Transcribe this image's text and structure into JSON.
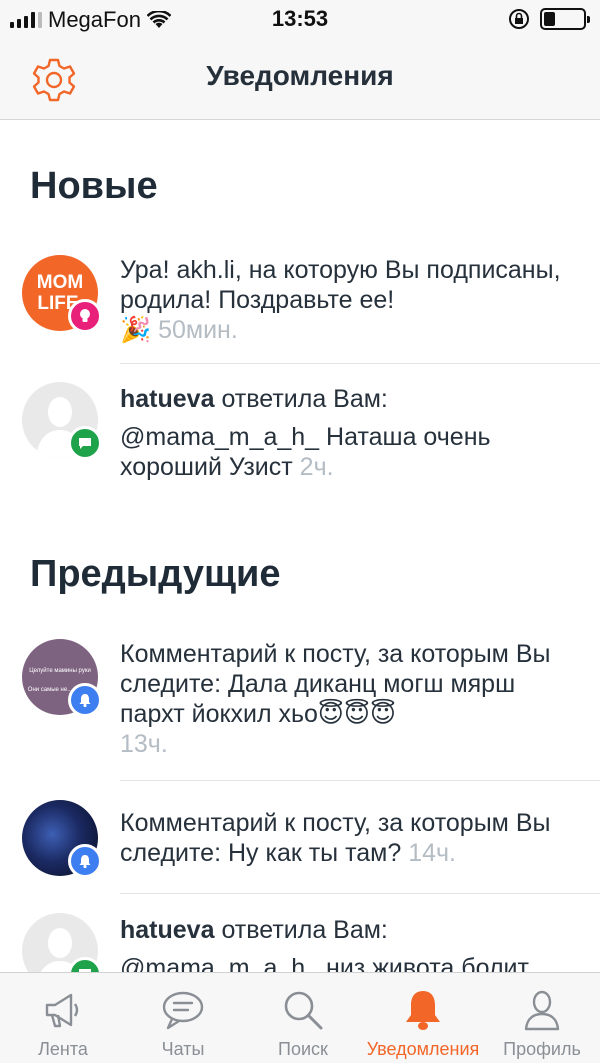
{
  "status_bar": {
    "carrier": "MegaFon",
    "time": "13:53"
  },
  "header": {
    "title": "Уведомления"
  },
  "sections": {
    "new_title": "Новые",
    "previous_title": "Предыдущие"
  },
  "notifications": [
    {
      "text": "Ура! akh.li, на которую Вы подписаны, родила! Поздравьте ее!",
      "emoji": "🎉",
      "time": "50мин.",
      "avatar_text": "MOM LIFE",
      "badge_icon": "lightbulb-icon"
    },
    {
      "user": "hatueva",
      "action": "ответила Вам:",
      "text": "@mama_m_a_h_ Наташа очень хороший Узист",
      "time": "2ч.",
      "badge_icon": "chat-icon"
    },
    {
      "text": "Комментарий к посту, за которым Вы следите: Дала диканц могш мярш пархт йокхил хьо",
      "emoji": "😇😇😇",
      "time": "13ч.",
      "avatar_text_1": "Целуйте мамины руки",
      "avatar_text_2": "Они самые не...",
      "badge_icon": "bell-icon"
    },
    {
      "text": "Комментарий к посту, за которым Вы следите: Ну как ты там?",
      "time": "14ч.",
      "badge_icon": "bell-icon"
    },
    {
      "user": "hatueva",
      "action": "ответила Вам:",
      "text": "@mama_m_a_h_ низ живота болит",
      "badge_icon": "chat-icon"
    }
  ],
  "tabs": [
    {
      "label": "Лента",
      "icon": "megaphone-icon"
    },
    {
      "label": "Чаты",
      "icon": "chat-bubble-icon"
    },
    {
      "label": "Поиск",
      "icon": "search-icon"
    },
    {
      "label": "Уведомления",
      "icon": "bell-icon",
      "active": true
    },
    {
      "label": "Профиль",
      "icon": "profile-icon"
    }
  ],
  "colors": {
    "accent": "#f26628",
    "badge_green": "#1fa34a",
    "badge_blue": "#3d7ef0",
    "badge_pink": "#e8207a"
  }
}
